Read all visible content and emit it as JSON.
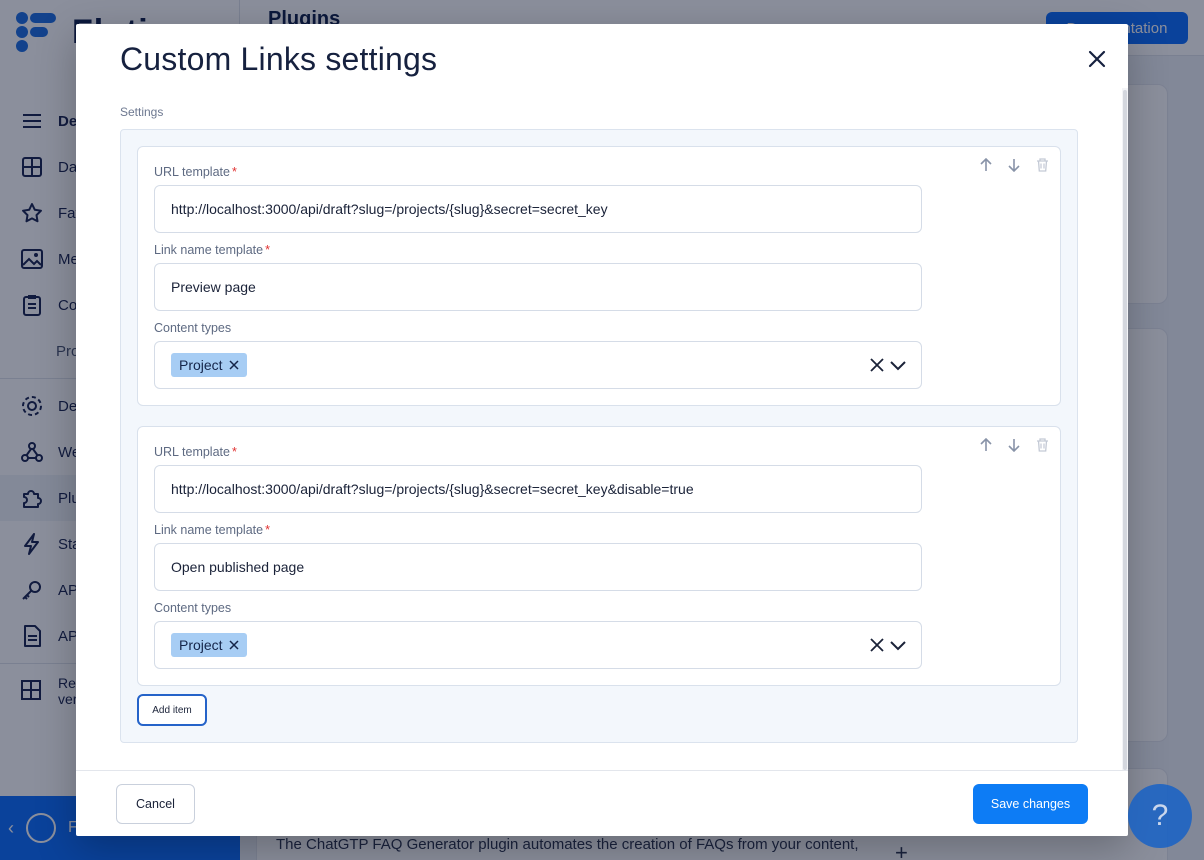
{
  "app": {
    "logo_text": "Flotiq",
    "page_title": "Plugins",
    "documentation_label": "Documentation",
    "nav_items": [
      {
        "label": "Dev",
        "icon": "menu-icon"
      },
      {
        "label": "Das",
        "icon": "dashboard-icon"
      },
      {
        "label": "Fav",
        "icon": "star-icon"
      },
      {
        "label": "Me",
        "icon": "image-icon"
      },
      {
        "label": "Co",
        "icon": "clipboard-icon"
      },
      {
        "label": "Pro",
        "icon": ""
      },
      {
        "label": "Def",
        "icon": "gear-icon"
      },
      {
        "label": "We",
        "icon": "webhook-icon"
      },
      {
        "label": "Plu",
        "icon": "puzzle-icon"
      },
      {
        "label": "Sta",
        "icon": "bolt-icon"
      },
      {
        "label": "API",
        "icon": "key-icon"
      },
      {
        "label": "API",
        "icon": "document-icon"
      },
      {
        "label": "Ret ver",
        "icon": "layout-icon"
      }
    ],
    "user_label": "F",
    "background_description": "The ChatGTP FAQ Generator plugin automates the creation of FAQs from your content,",
    "help_label": "?"
  },
  "modal": {
    "title": "Custom Links settings",
    "section_label": "Settings",
    "items": [
      {
        "url_label": "URL template",
        "url_value": "http://localhost:3000/api/draft?slug=/projects/{slug}&secret=secret_key",
        "name_label": "Link name template",
        "name_value": "Preview page",
        "types_label": "Content types",
        "types": [
          "Project"
        ]
      },
      {
        "url_label": "URL template",
        "url_value": "http://localhost:3000/api/draft?slug=/projects/{slug}&secret=secret_key&disable=true",
        "name_label": "Link name template",
        "name_value": "Open published page",
        "types_label": "Content types",
        "types": [
          "Project"
        ]
      }
    ],
    "required_mark": "*",
    "add_item_label": "Add item",
    "cancel_label": "Cancel",
    "save_label": "Save changes"
  },
  "colors": {
    "primary": "#0d7cf5",
    "chip": "#a7cdf4",
    "overlay": "rgba(8,18,45,0.47)"
  }
}
